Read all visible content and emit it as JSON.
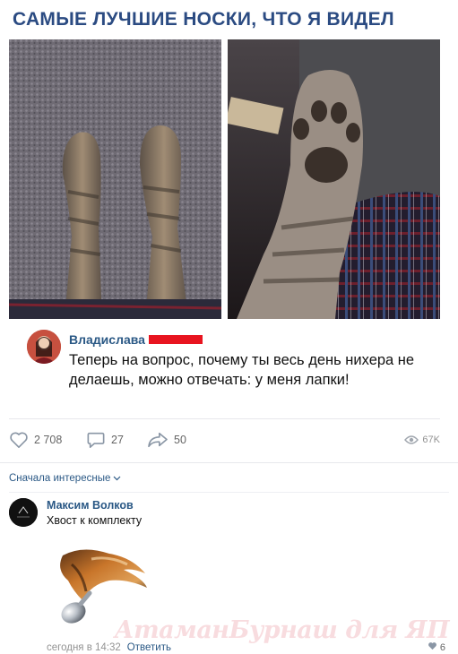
{
  "title": "САМЫЕ ЛУЧШИЕ НОСКИ, ЧТО Я ВИДЕЛ",
  "quote": {
    "author": "Владислава",
    "text": "Теперь на вопрос, почему ты весь день нихера не делаешь, можно отвечать: у меня лапки!"
  },
  "actions": {
    "likes": "2 708",
    "comments": "27",
    "shares": "50",
    "views": "67K"
  },
  "comments_section": {
    "sort_label": "Сначала интересные",
    "comment": {
      "author": "Максим Волков",
      "text": "Хвост к комплекту",
      "time": "сегодня в 14:32",
      "reply_label": "Ответить",
      "likes": "6"
    }
  },
  "watermark": "АтаманБурнаш для ЯП",
  "icons": [
    "heart-icon",
    "comment-icon",
    "share-icon",
    "eye-icon",
    "chevron-down-icon",
    "small-heart-icon"
  ],
  "colors": {
    "title": "#2b4b82",
    "link": "#2a5885",
    "redacted": "#e8141f",
    "meta": "#939393"
  }
}
